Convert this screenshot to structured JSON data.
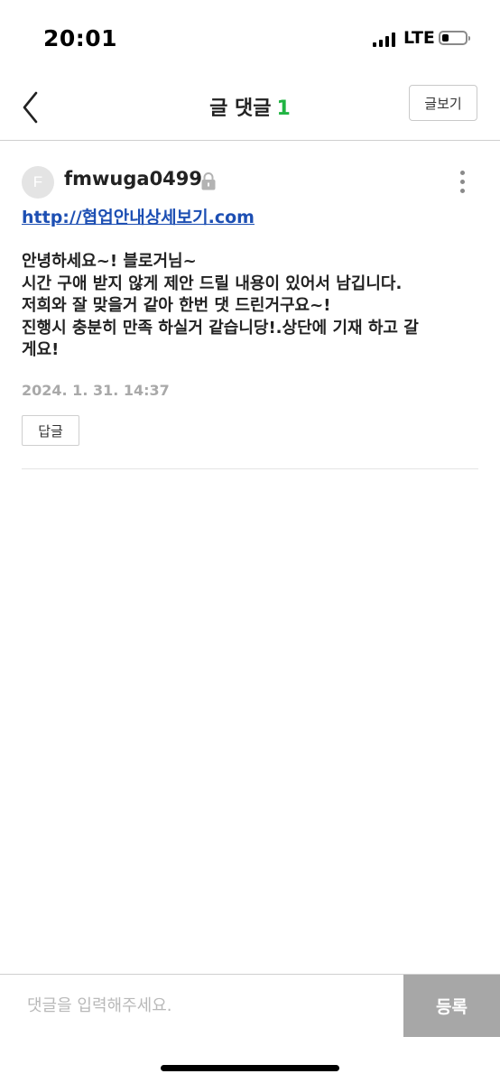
{
  "status_bar": {
    "time": "20:01",
    "network": "LTE",
    "battery_level": 0.3
  },
  "header": {
    "back_icon": "chevron-left-icon",
    "title": "글 댓글",
    "comment_count": "1",
    "count_color": "#21b443",
    "view_post_label": "글보기"
  },
  "comment": {
    "avatar_initial": "F",
    "author": "fmwuga0499",
    "lock_icon": "lock-icon",
    "more_icon": "more-vertical-icon",
    "link": "http://협업안내상세보기.com",
    "link_color": "#1d4fb3",
    "lines": [
      "안녕하세요~! 블로거님~",
      "시간 구애 받지 않게 제안 드릴 내용이 있어서 남깁니다.",
      "저희와 잘 맞을거 같아 한번 댓 드린거구요~!",
      "진행시 충분히 만족 하실거 같습니당!.상단에 기재 하고 갈",
      "게요!"
    ],
    "date": "2024. 1. 31. 14:37",
    "reply_label": "답글"
  },
  "input_bar": {
    "placeholder": "댓글을 입력해주세요.",
    "submit_label": "등록",
    "submit_color": "#a7a7a7"
  }
}
